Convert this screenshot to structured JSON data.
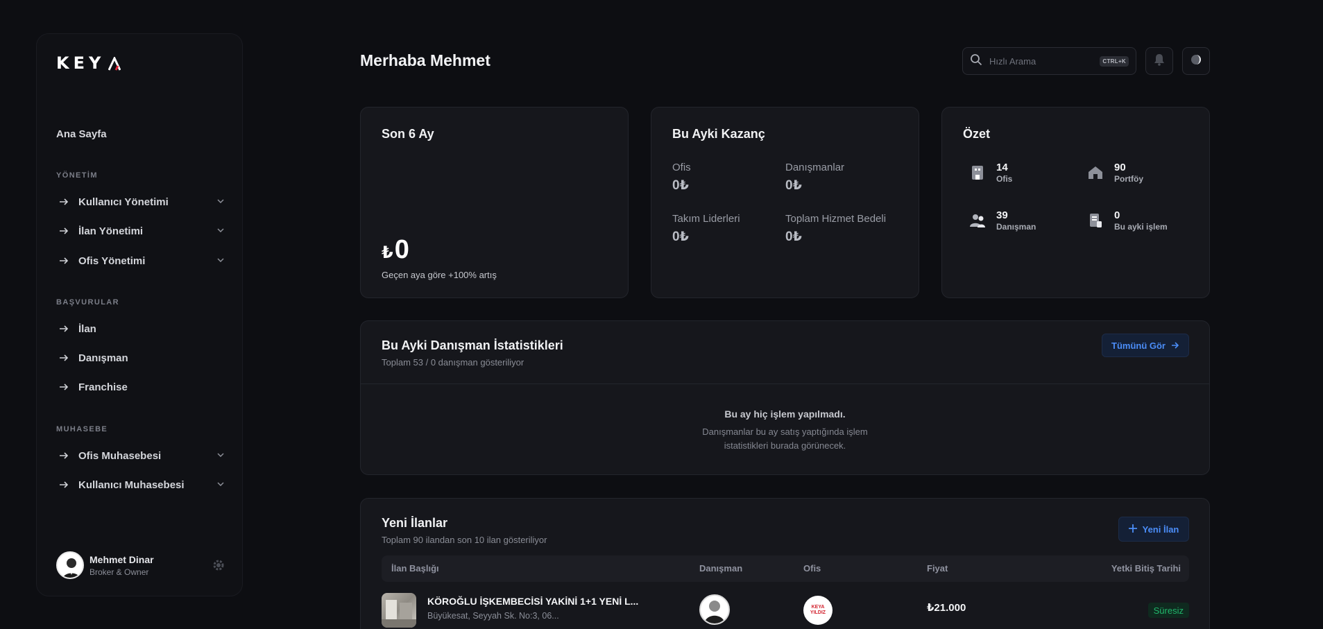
{
  "brand": {
    "logo_text": "KEY",
    "accent_color": "#e0273a"
  },
  "sidebar": {
    "home": "Ana Sayfa",
    "sections": [
      {
        "title": "YÖNETİM",
        "items": [
          {
            "label": "Kullanıcı Yönetimi",
            "expandable": true
          },
          {
            "label": "İlan Yönetimi",
            "expandable": true
          },
          {
            "label": "Ofis Yönetimi",
            "expandable": true
          }
        ]
      },
      {
        "title": "BAŞVURULAR",
        "items": [
          {
            "label": "İlan",
            "expandable": false
          },
          {
            "label": "Danışman",
            "expandable": false
          },
          {
            "label": "Franchise",
            "expandable": false
          }
        ]
      },
      {
        "title": "MUHASEBE",
        "items": [
          {
            "label": "Ofis Muhasebesi",
            "expandable": true
          },
          {
            "label": "Kullanıcı Muhasebesi",
            "expandable": true
          }
        ]
      }
    ],
    "user": {
      "name": "Mehmet Dinar",
      "role": "Broker & Owner"
    }
  },
  "header": {
    "greeting": "Merhaba Mehmet",
    "search_placeholder": "Hızlı Arama",
    "search_shortcut": "CTRL+K"
  },
  "cards": {
    "last6": {
      "title": "Son 6 Ay",
      "currency": "₺",
      "amount": "0",
      "growth": "Geçen aya göre +100% artış"
    },
    "earnings": {
      "title": "Bu Ayki Kazanç",
      "items": [
        {
          "label": "Ofis",
          "value": "0₺"
        },
        {
          "label": "Danışmanlar",
          "value": "0₺"
        },
        {
          "label": "Takım Liderleri",
          "value": "0₺"
        },
        {
          "label": "Toplam Hizmet Bedeli",
          "value": "0₺"
        }
      ]
    },
    "summary": {
      "title": "Özet",
      "items": [
        {
          "value": "14",
          "label": "Ofis",
          "icon": "office-icon"
        },
        {
          "value": "90",
          "label": "Portföy",
          "icon": "home-icon"
        },
        {
          "value": "39",
          "label": "Danışman",
          "icon": "users-icon"
        },
        {
          "value": "0",
          "label": "Bu ayki işlem",
          "icon": "transaction-icon"
        }
      ]
    }
  },
  "advisor_stats": {
    "title": "Bu Ayki Danışman İstatistikleri",
    "subtitle": "Toplam 53 / 0 danışman gösteriliyor",
    "button": "Tümünü Gör",
    "empty_title": "Bu ay hiç işlem yapılmadı.",
    "empty_desc": "Danışmanlar bu ay satış yaptığında işlem istatistikleri burada görünecek."
  },
  "listings": {
    "title": "Yeni İlanlar",
    "subtitle": "Toplam 90 ilandan son 10 ilan gösteriliyor",
    "button": "Yeni İlan",
    "columns": [
      "İlan Başlığı",
      "Danışman",
      "Ofis",
      "Fiyat",
      "Yetki Bitiş Tarihi"
    ],
    "rows": [
      {
        "title": "KÖROĞLU İŞKEMBECİSİ YAKİNİ 1+1 YENİ L...",
        "address": "Büyükesat, Seyyah Sk. No:3, 06...",
        "office_logo_top": "KEYA",
        "office_logo_bottom": "YILDIZ",
        "price": "₺21.000",
        "expiry": "Süresiz"
      }
    ]
  }
}
